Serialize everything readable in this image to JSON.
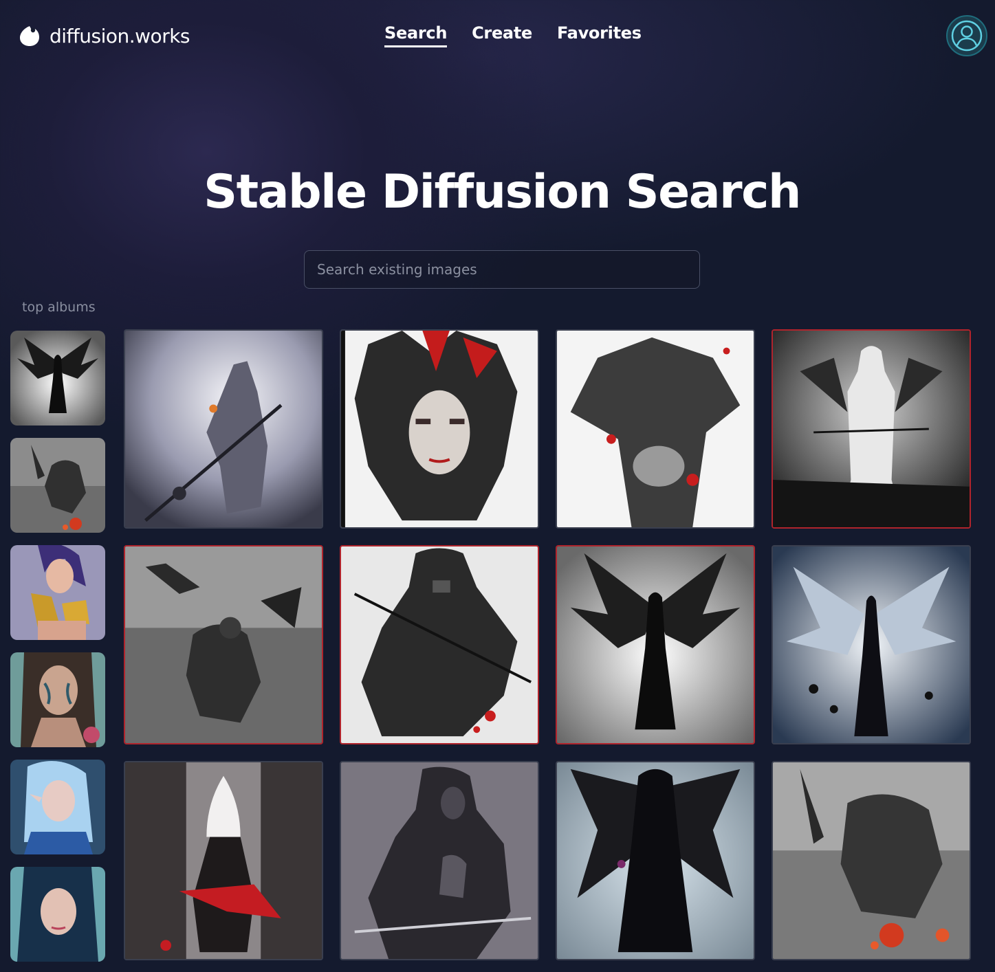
{
  "brand": {
    "name": "diffusion.works",
    "logo_icon": "droplet-logo-icon"
  },
  "nav": {
    "items": [
      {
        "label": "Search",
        "active": true
      },
      {
        "label": "Create",
        "active": false
      },
      {
        "label": "Favorites",
        "active": false
      }
    ]
  },
  "account": {
    "icon": "user-avatar-icon"
  },
  "page": {
    "title": "Stable Diffusion Search"
  },
  "search": {
    "placeholder": "Search existing images",
    "value": ""
  },
  "albums": {
    "label": "top albums",
    "count_visible": 6
  },
  "results": {
    "columns": 4,
    "highlight_color": "#b0242c",
    "items": [
      {
        "row": 1,
        "col": 1,
        "highlighted": false
      },
      {
        "row": 1,
        "col": 2,
        "highlighted": false
      },
      {
        "row": 1,
        "col": 3,
        "highlighted": false
      },
      {
        "row": 1,
        "col": 4,
        "highlighted": true
      },
      {
        "row": 2,
        "col": 1,
        "highlighted": true
      },
      {
        "row": 2,
        "col": 2,
        "highlighted": true
      },
      {
        "row": 2,
        "col": 3,
        "highlighted": true
      },
      {
        "row": 2,
        "col": 4,
        "highlighted": false
      },
      {
        "row": 3,
        "col": 1,
        "highlighted": false
      },
      {
        "row": 3,
        "col": 2,
        "highlighted": false
      },
      {
        "row": 3,
        "col": 3,
        "highlighted": false
      },
      {
        "row": 3,
        "col": 4,
        "highlighted": false
      }
    ]
  },
  "colors": {
    "background": "#141a2e",
    "accent_avatar": "#1f6d7d",
    "text": "#ffffff",
    "muted": "#8a8fa0"
  }
}
